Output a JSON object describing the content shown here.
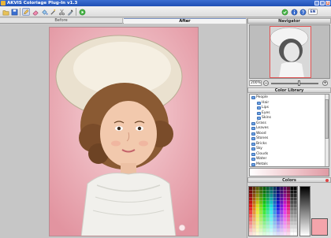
{
  "window": {
    "title": "AKVIS Coloriage Plug-In v1.3",
    "buttons": [
      "_",
      "□",
      "x"
    ]
  },
  "toolbar": {
    "tools": [
      "open-icon",
      "save-icon",
      "pencil-icon",
      "eraser-icon",
      "bucket-icon",
      "magic-wand-icon",
      "scissors-icon",
      "eyedropper-icon",
      "run-icon"
    ],
    "right_tools": [
      "ok-icon",
      "info-icon",
      "help-icon"
    ],
    "language": "EN"
  },
  "tabs": {
    "before": "Before",
    "after": "After",
    "active": "After"
  },
  "navigator": {
    "title": "Navigator",
    "zoom": "200%",
    "zoom_out": "−",
    "zoom_in": "+"
  },
  "library": {
    "title": "Color Library",
    "items": [
      {
        "label": "People",
        "depth": 0
      },
      {
        "label": "Hair",
        "depth": 1
      },
      {
        "label": "Lips",
        "depth": 1
      },
      {
        "label": "Eyes",
        "depth": 1
      },
      {
        "label": "Skins",
        "depth": 1
      },
      {
        "label": "Grass",
        "depth": 0
      },
      {
        "label": "Leaves",
        "depth": 0
      },
      {
        "label": "Wood",
        "depth": 0
      },
      {
        "label": "Stones",
        "depth": 0
      },
      {
        "label": "Bricks",
        "depth": 0
      },
      {
        "label": "Sky",
        "depth": 0
      },
      {
        "label": "Clouds",
        "depth": 0
      },
      {
        "label": "Water",
        "depth": 0
      },
      {
        "label": "Metals",
        "depth": 0
      }
    ]
  },
  "colors": {
    "title": "Colors",
    "selected": "#f4a4ab"
  },
  "accent": "#2d5fc4"
}
